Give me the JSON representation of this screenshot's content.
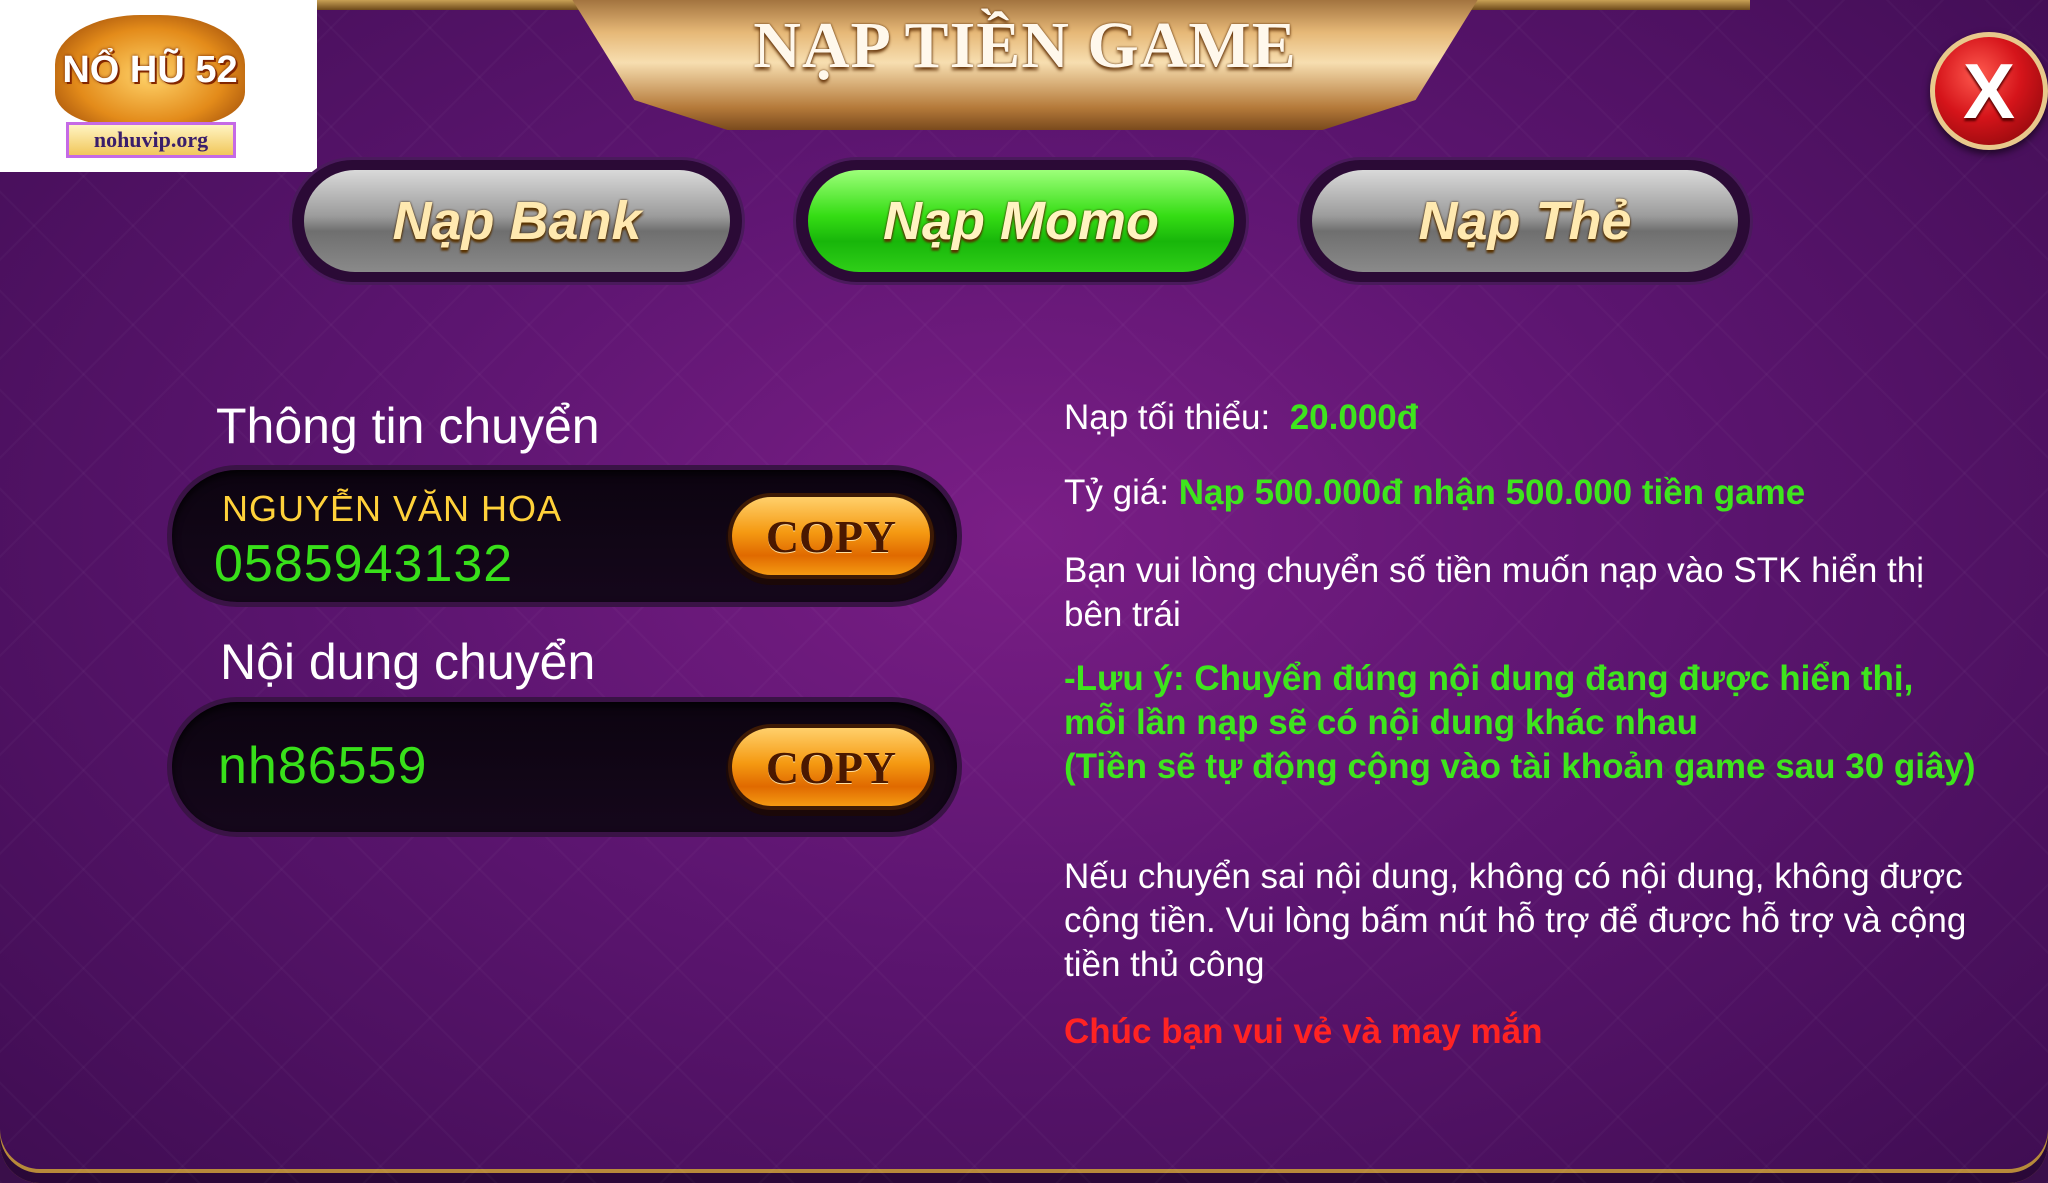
{
  "title": "NẠP TIỀN GAME",
  "logo": {
    "brand_text": "NỔ HŨ 52",
    "url_text": "nohuvip.org"
  },
  "close_label": "X",
  "tabs": [
    {
      "label": "Nạp Bank",
      "active": false
    },
    {
      "label": "Nạp Momo",
      "active": true
    },
    {
      "label": "Nạp Thẻ",
      "active": false
    }
  ],
  "transfer_info": {
    "label": "Thông tin chuyển",
    "name": "NGUYỄN VĂN HOA",
    "account": "0585943132",
    "copy_label": "COPY"
  },
  "transfer_content": {
    "label": "Nội dung chuyển",
    "code": "nh86559",
    "copy_label": "COPY"
  },
  "details": {
    "min_label": "Nạp tối thiểu:",
    "min_value": "20.000đ",
    "rate_label": "Tỷ giá:",
    "rate_value": "Nạp 500.000đ nhận 500.000 tiền game",
    "instruction": "Bạn vui lòng chuyển số tiền muốn nạp vào STK hiển thị bên trái",
    "note_line1": "-Lưu ý: Chuyển đúng nội dung đang được hiển thị, mỗi lần nạp sẽ có nội dung khác nhau",
    "note_line2": "(Tiền sẽ tự động cộng vào tài khoản game sau 30 giây)",
    "warning": "Nếu chuyển sai nội dung, không có nội dung, không được cộng tiền. Vui lòng bấm nút hỗ trợ để được hỗ trợ và cộng tiền thủ công",
    "wish": "Chúc bạn vui vẻ và may mắn"
  },
  "colors": {
    "highlight_green": "#3ee51d",
    "name_yellow": "#ffd23a",
    "wish_red": "#ff2323",
    "panel_purple": "#5c1570"
  }
}
